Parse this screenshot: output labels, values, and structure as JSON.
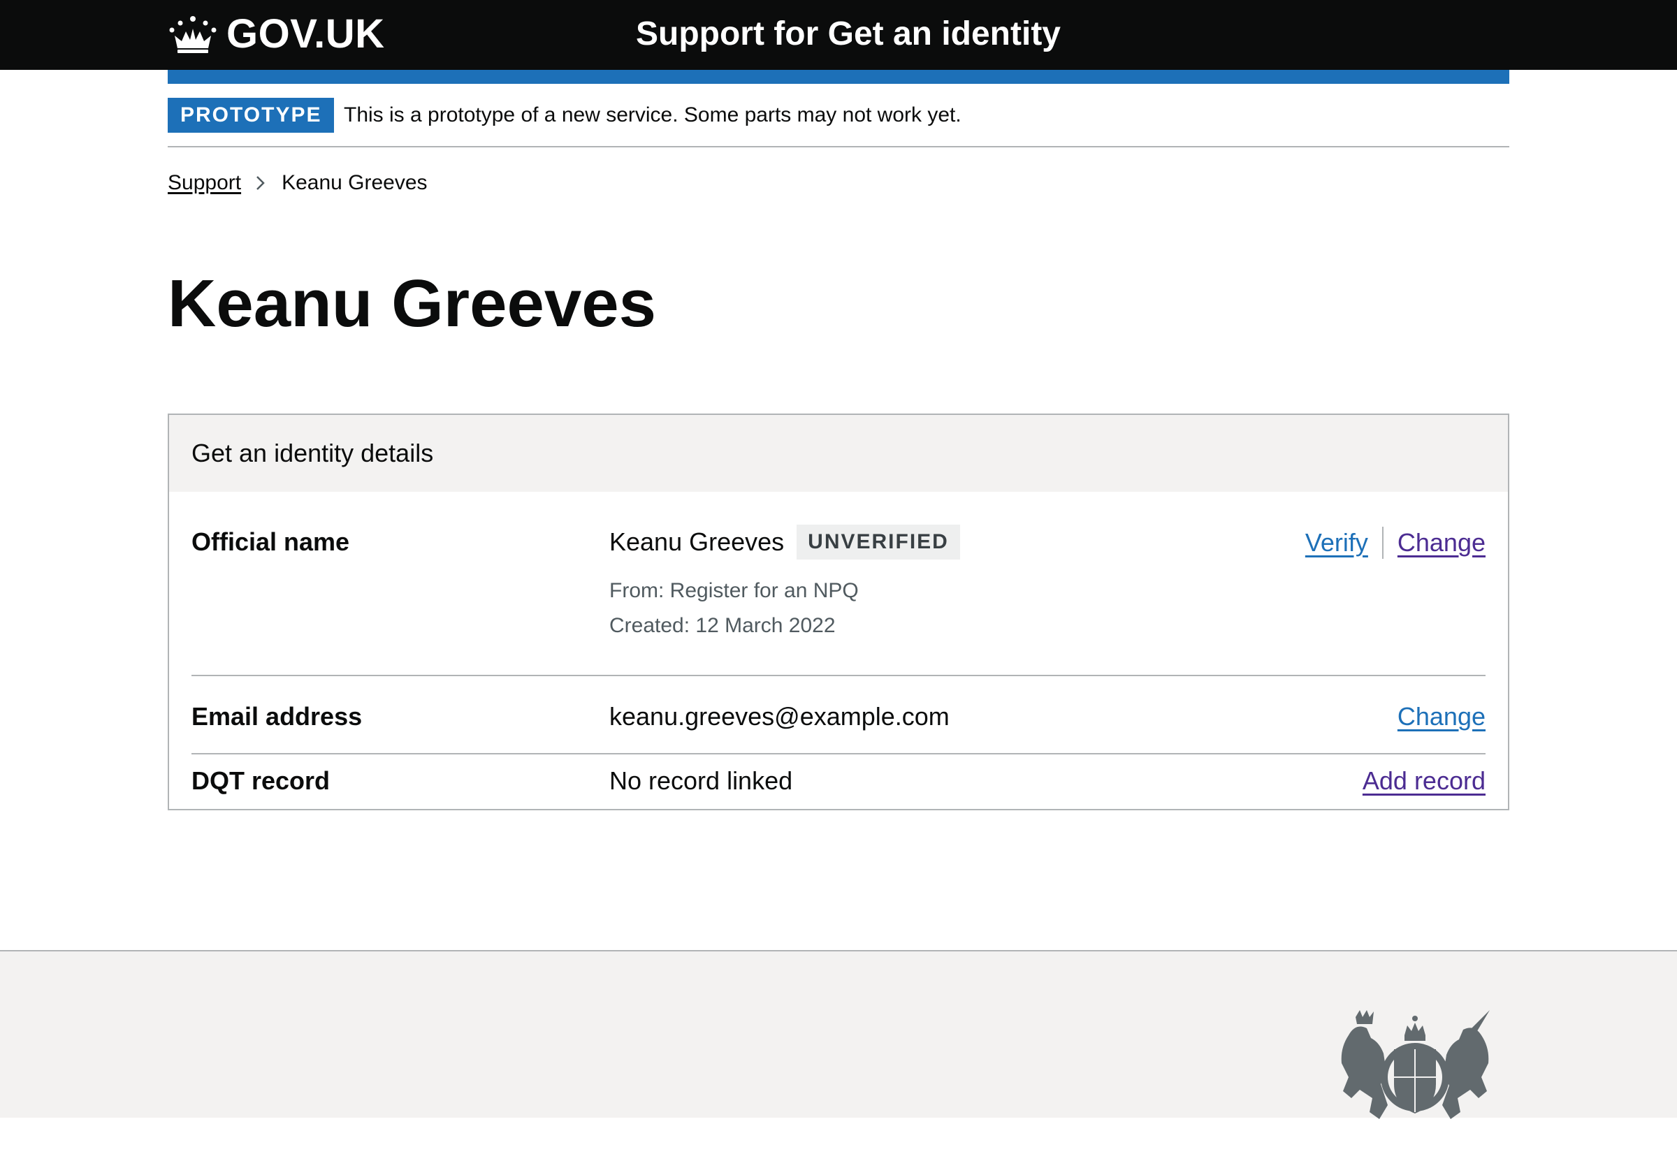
{
  "header": {
    "logo_text": "GOV.UK",
    "service_name": "Support for Get an identity"
  },
  "phase_banner": {
    "tag": "PROTOTYPE",
    "text": "This is a prototype of a new service. Some parts may not work yet."
  },
  "breadcrumbs": [
    {
      "label": "Support"
    },
    {
      "label": "Keanu Greeves"
    }
  ],
  "page": {
    "title": "Keanu Greeves"
  },
  "card": {
    "title": "Get an identity details",
    "rows": [
      {
        "key": "Official name",
        "value": "Keanu Greeves",
        "tag": "UNVERIFIED",
        "meta_from": "From: Register for an NPQ",
        "meta_created": "Created: 12 March 2022",
        "actions": [
          "Verify",
          "Change"
        ]
      },
      {
        "key": "Email address",
        "value": "keanu.greeves@example.com",
        "actions": [
          "Change"
        ]
      },
      {
        "key": "DQT record",
        "value": "No record linked",
        "actions": [
          "Add record"
        ]
      }
    ]
  },
  "colors": {
    "header_bg": "#0b0c0c",
    "brand_blue": "#1d70b8",
    "visited_link": "#4c2c92",
    "border": "#b1b4b6",
    "card_header_bg": "#f3f2f1",
    "tag_grey_bg": "#eeefef"
  },
  "icons": {
    "logo": "crown-icon",
    "breadcrumb_separator": "chevron-right-icon",
    "footer": "royal-crest-icon"
  }
}
